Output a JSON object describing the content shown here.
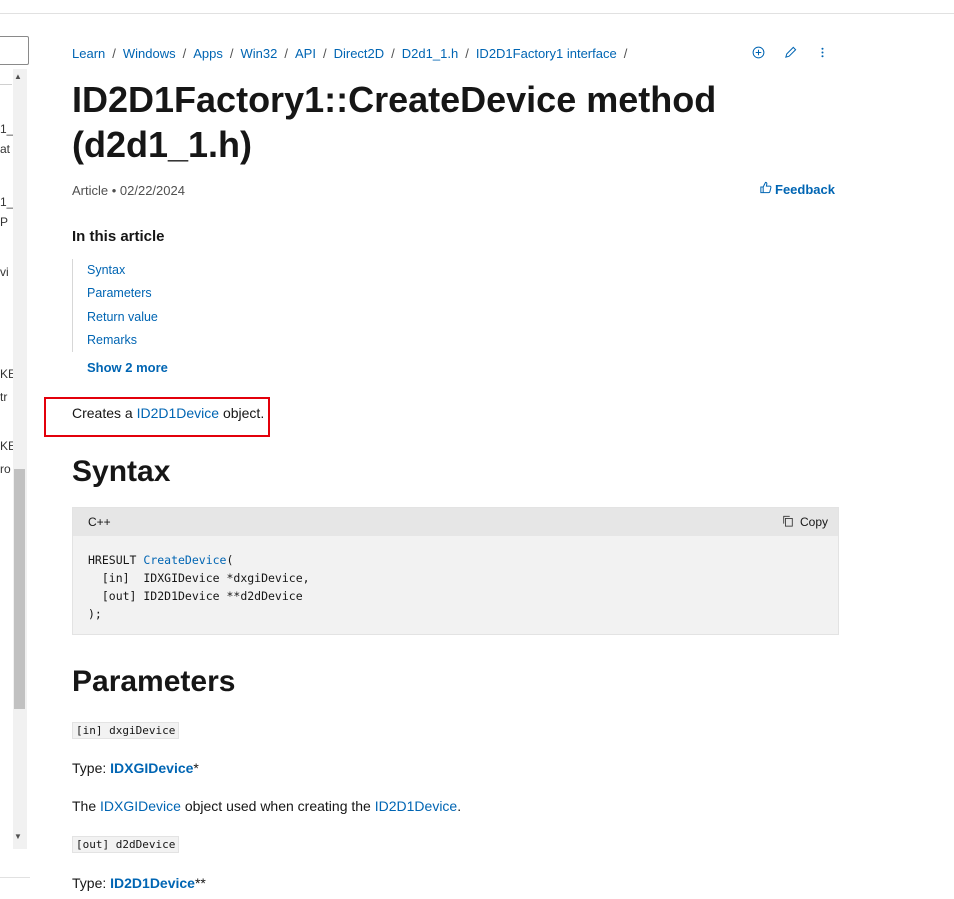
{
  "breadcrumb": [
    "Learn",
    "Windows",
    "Apps",
    "Win32",
    "API",
    "Direct2D",
    "D2d1_1.h",
    "ID2D1Factory1 interface"
  ],
  "breadcrumb_sep": "/",
  "title": "ID2D1Factory1::CreateDevice method (d2d1_1.h)",
  "meta": "Article • 02/22/2024",
  "feedback_label": "Feedback",
  "toc": {
    "heading": "In this article",
    "items": [
      "Syntax",
      "Parameters",
      "Return value",
      "Remarks"
    ],
    "show_more": "Show 2 more"
  },
  "description": {
    "before": "Creates a ",
    "link": "ID2D1Device",
    "after": " object."
  },
  "syntax": {
    "heading": "Syntax",
    "language": "C++",
    "copy_label": "Copy",
    "code_prefix": "HRESULT ",
    "code_fn": "CreateDevice",
    "code_rest": "(\n  [in]  IDXGIDevice *dxgiDevice,\n  [out] ID2D1Device **d2dDevice\n);"
  },
  "parameters": {
    "heading": "Parameters",
    "param1": {
      "name": "[in] dxgiDevice",
      "type_label": "Type: ",
      "type_link": "IDXGIDevice",
      "type_suffix": "*",
      "desc_before": "The ",
      "desc_link1": "IDXGIDevice",
      "desc_mid": " object used when creating the ",
      "desc_link2": "ID2D1Device",
      "desc_after": "."
    },
    "param2": {
      "name": "[out] d2dDevice",
      "type_label": "Type: ",
      "type_link": "ID2D1Device",
      "type_suffix": "**"
    }
  },
  "sidebar_fragments": [
    "1_",
    "at",
    "1_",
    "P",
    "vi",
    "KE",
    "tr",
    "KE",
    "ro"
  ],
  "icons": {
    "add": "circle-plus-icon",
    "edit": "pencil-icon",
    "more": "more-vertical-icon",
    "feedback": "thumbs-up-icon",
    "copy": "copy-icon"
  },
  "colors": {
    "link": "#0065b3",
    "highlight": "#e3000b",
    "code_bg": "#f2f2f2"
  }
}
